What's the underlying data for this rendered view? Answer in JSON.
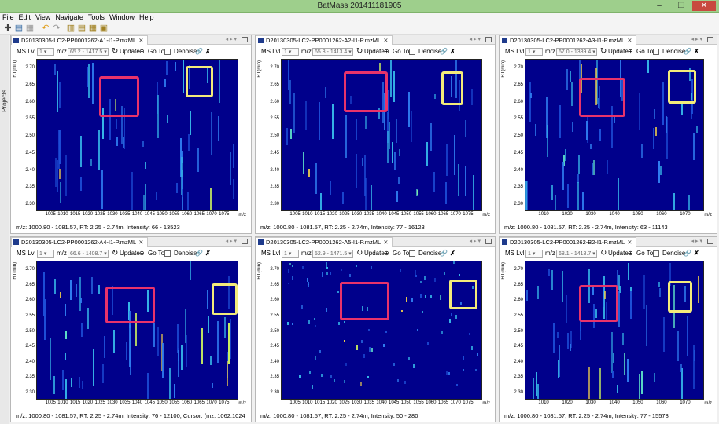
{
  "window": {
    "title": "BatMass 201411181905"
  },
  "menu": [
    "File",
    "Edit",
    "View",
    "Navigate",
    "Tools",
    "Window",
    "Help"
  ],
  "sidebar": {
    "label": "Projects"
  },
  "controls": {
    "ms_lvl_label": "MS Lvl",
    "ms_lvl_value": "1",
    "mz_label": "m/z",
    "update_label": "Update",
    "goto_label": "Go To",
    "denoise_label": "Denoise"
  },
  "axis": {
    "y_label": "RT(min)",
    "x_unit": "m/z"
  },
  "panels": [
    {
      "tab": "D20130305-LC2-PP0001262-A1-I1-P.mzML",
      "mz_range": "65.2 - 1417.5",
      "status": "m/z: 1000.80 - 1081.57, RT: 2.25 - 2.74m, Intensity: 66 - 13523",
      "yticks": [
        "2.70",
        "2.65",
        "2.60",
        "2.55",
        "2.50",
        "2.45",
        "2.40",
        "2.35",
        "2.30"
      ],
      "xticks": [
        "1005",
        "1010",
        "1015",
        "1020",
        "1025",
        "1030",
        "1035",
        "1040",
        "1045",
        "1050",
        "1055",
        "1060",
        "1065",
        "1070",
        "1075"
      ]
    },
    {
      "tab": "D20130305-LC2-PP0001262-A2-I1-P.mzML",
      "mz_range": "65.8 - 1413.4",
      "status": "m/z: 1000.80 - 1081.57, RT: 2.25 - 2.74m, Intensity: 77 - 16123",
      "yticks": [
        "2.70",
        "2.65",
        "2.60",
        "2.55",
        "2.50",
        "2.45",
        "2.40",
        "2.35",
        "2.30"
      ],
      "xticks": [
        "1005",
        "1010",
        "1015",
        "1020",
        "1025",
        "1030",
        "1035",
        "1040",
        "1045",
        "1050",
        "1055",
        "1060",
        "1065",
        "1070",
        "1075"
      ]
    },
    {
      "tab": "D20130305-LC2-PP0001262-A3-I1-P.mzML",
      "mz_range": "67.0 - 1389.4",
      "status": "m/z: 1000.80 - 1081.57, RT: 2.25 - 2.74m, Intensity: 63 - 11143",
      "yticks": [
        "2.70",
        "2.65",
        "2.60",
        "2.55",
        "2.50",
        "2.45",
        "2.40",
        "2.35",
        "2.30"
      ],
      "xticks": [
        "1010",
        "1020",
        "1030",
        "1040",
        "1050",
        "1060",
        "1070"
      ]
    },
    {
      "tab": "D20130305-LC2-PP0001262-A4-I1-P.mzML",
      "mz_range": "66.6 - 1408.7",
      "status": "m/z: 1000.80 - 1081.57, RT: 2.25 - 2.74m, Intensity: 76 - 12100, Cursor: (mz: 1062.1024 rt: 2.50m)",
      "yticks": [
        "2.70",
        "2.65",
        "2.60",
        "2.55",
        "2.50",
        "2.45",
        "2.40",
        "2.35",
        "2.30"
      ],
      "xticks": [
        "1005",
        "1010",
        "1015",
        "1020",
        "1025",
        "1030",
        "1035",
        "1040",
        "1045",
        "1050",
        "1055",
        "1060",
        "1065",
        "1070",
        "1075"
      ]
    },
    {
      "tab": "D20130305-LC2-PP0001262-A5-I1-P.mzML",
      "mz_range": "52.9 - 1471.5",
      "status": "m/z: 1000.80 - 1081.57, RT: 2.25 - 2.74m, Intensity: 50 - 280",
      "yticks": [
        "2.70",
        "2.65",
        "2.60",
        "2.55",
        "2.50",
        "2.45",
        "2.40",
        "2.35",
        "2.30"
      ],
      "xticks": [
        "1005",
        "1010",
        "1015",
        "1020",
        "1025",
        "1030",
        "1035",
        "1040",
        "1045",
        "1050",
        "1055",
        "1060",
        "1065",
        "1070",
        "1075"
      ]
    },
    {
      "tab": "D20130305-LC2-PP0001262-B2-I1-P.mzML",
      "mz_range": "68.1 - 1418.7",
      "status": "m/z: 1000.80 - 1081.57, RT: 2.25 - 2.74m, Intensity: 77 - 15578",
      "yticks": [
        "2.70",
        "2.65",
        "2.60",
        "2.55",
        "2.50",
        "2.45",
        "2.40",
        "2.35",
        "2.30"
      ],
      "xticks": [
        "1010",
        "1020",
        "1030",
        "1040",
        "1050",
        "1060",
        "1070"
      ]
    }
  ],
  "colors": {
    "heatmap_bg": "#00008b",
    "highlight_red": "#e8336b",
    "highlight_yellow": "#f3eb7a",
    "titlebar": "#9ecf8c"
  }
}
